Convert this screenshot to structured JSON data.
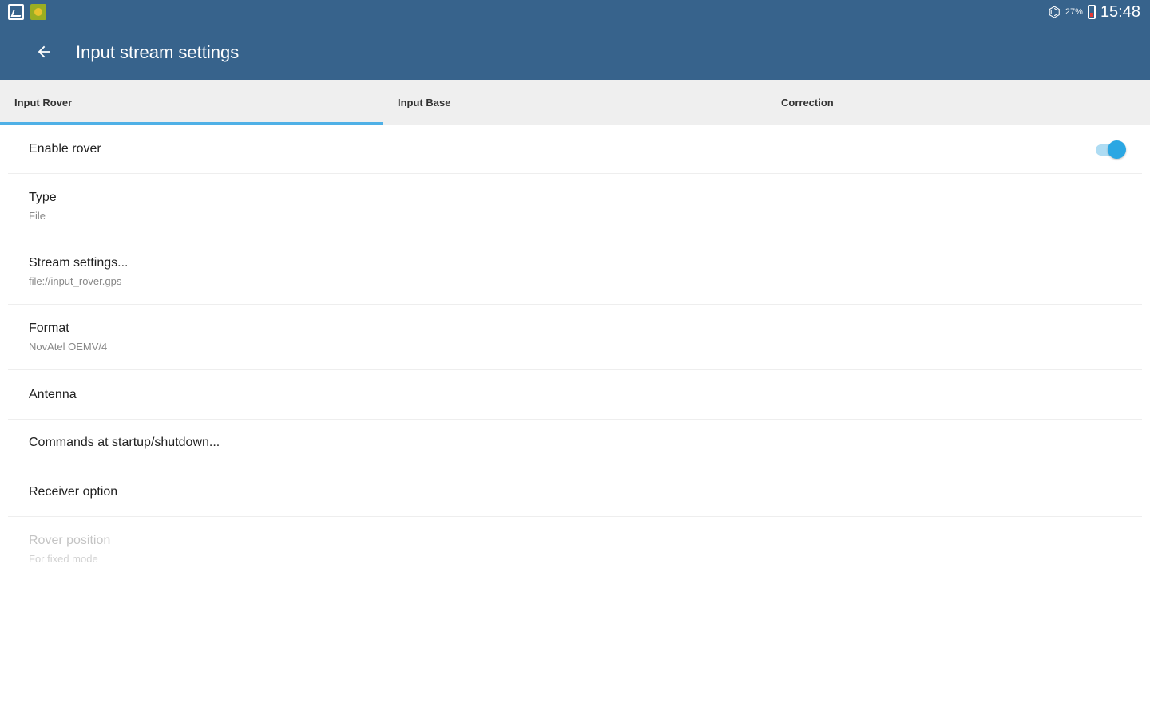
{
  "status_bar": {
    "left_icons": [
      "gallery-icon",
      "app-icon"
    ],
    "wifi_icon": "wifi-icon",
    "battery_percent": "27%",
    "battery_icon": "battery-low-icon",
    "time": "15:48"
  },
  "toolbar": {
    "back_icon": "arrow-back-icon",
    "title": "Input stream settings"
  },
  "tabs": [
    {
      "label": "Input Rover",
      "selected": true
    },
    {
      "label": "Input Base",
      "selected": false
    },
    {
      "label": "Correction",
      "selected": false
    }
  ],
  "preferences": [
    {
      "title": "Enable rover",
      "summary": "",
      "switch_on": true,
      "enabled": true
    },
    {
      "title": "Type",
      "summary": "File",
      "enabled": true
    },
    {
      "title": "Stream settings...",
      "summary": "file://input_rover.gps",
      "enabled": true
    },
    {
      "title": "Format",
      "summary": "NovAtel OEMV/4",
      "enabled": true
    },
    {
      "title": "Antenna",
      "summary": "",
      "enabled": true
    },
    {
      "title": "Commands at startup/shutdown...",
      "summary": "",
      "enabled": true
    },
    {
      "title": "Receiver option",
      "summary": "",
      "enabled": true
    },
    {
      "title": "Rover position",
      "summary": "For fixed mode",
      "enabled": false
    }
  ],
  "colors": {
    "app_bar": "#37638c",
    "tab_bar": "#efefef",
    "tab_indicator": "#4fb0e6",
    "switch_on": "#2ba7e3"
  }
}
